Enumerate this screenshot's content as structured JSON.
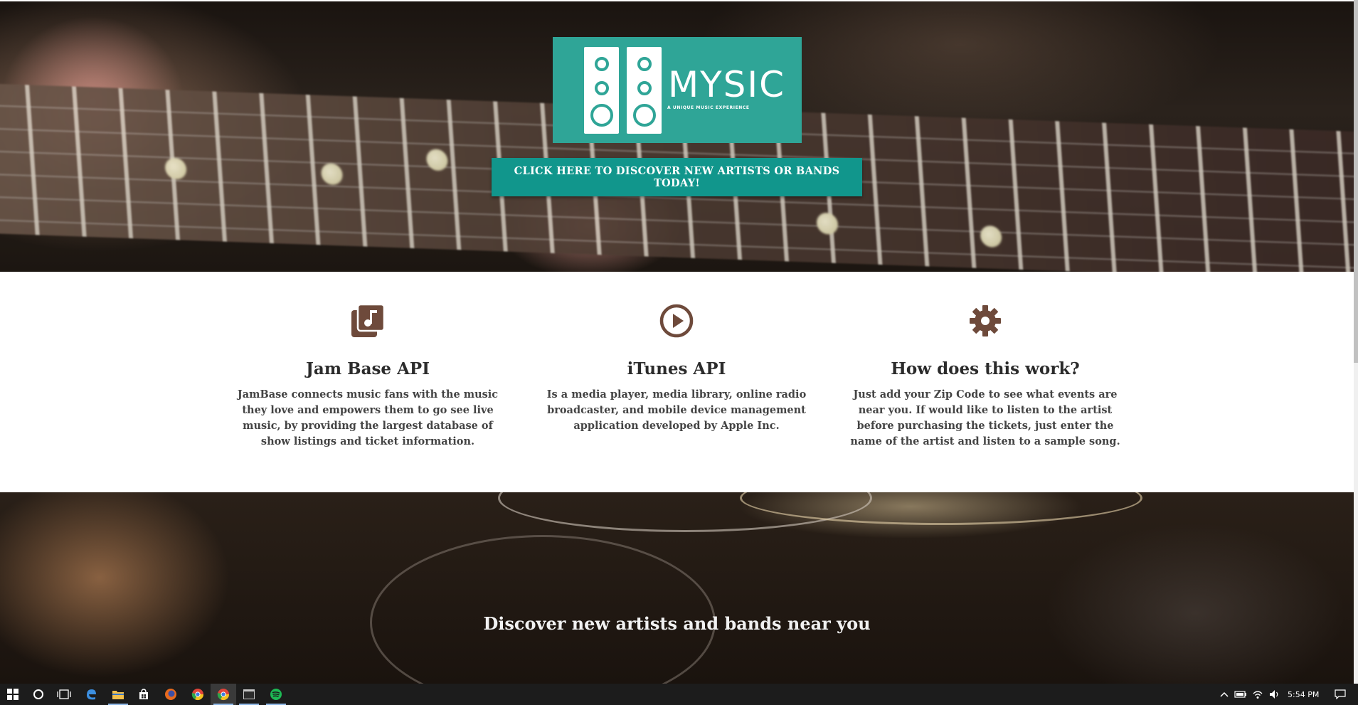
{
  "hero": {
    "logo_text": "MYSIC",
    "logo_tagline": "A UNIQUE MUSIC EXPERIENCE",
    "cta_label": "CLICK HERE TO DISCOVER NEW ARTISTS OR BANDS TODAY!"
  },
  "features": [
    {
      "icon": "music-library-icon",
      "title": "Jam Base API",
      "text": "JamBase connects music fans with the music they love and empowers them to go see live music, by providing the largest database of show listings and ticket information."
    },
    {
      "icon": "play-circle-icon",
      "title": "iTunes API",
      "text": "Is a media player, media library, online radio broadcaster, and mobile device management application developed by Apple Inc."
    },
    {
      "icon": "gear-icon",
      "title": "How does this work?",
      "text": "Just add your Zip Code to see what events are near you. If would like to listen to the artist before purchasing the tickets, just enter the name of the artist and listen to a sample song."
    }
  ],
  "discover": {
    "heading": "Discover new artists and bands near you"
  },
  "taskbar": {
    "clock": "5:54 PM",
    "pinned": [
      "start-icon",
      "cortana-icon",
      "task-view-icon",
      "edge-icon",
      "file-explorer-icon",
      "store-icon",
      "firefox-icon",
      "chrome-icon",
      "chrome-profile-icon",
      "terminal-icon",
      "spotify-icon"
    ]
  },
  "colors": {
    "accent": "#11968c",
    "logo_bg": "#2fa597",
    "icon_brown": "#6e4a3b"
  }
}
